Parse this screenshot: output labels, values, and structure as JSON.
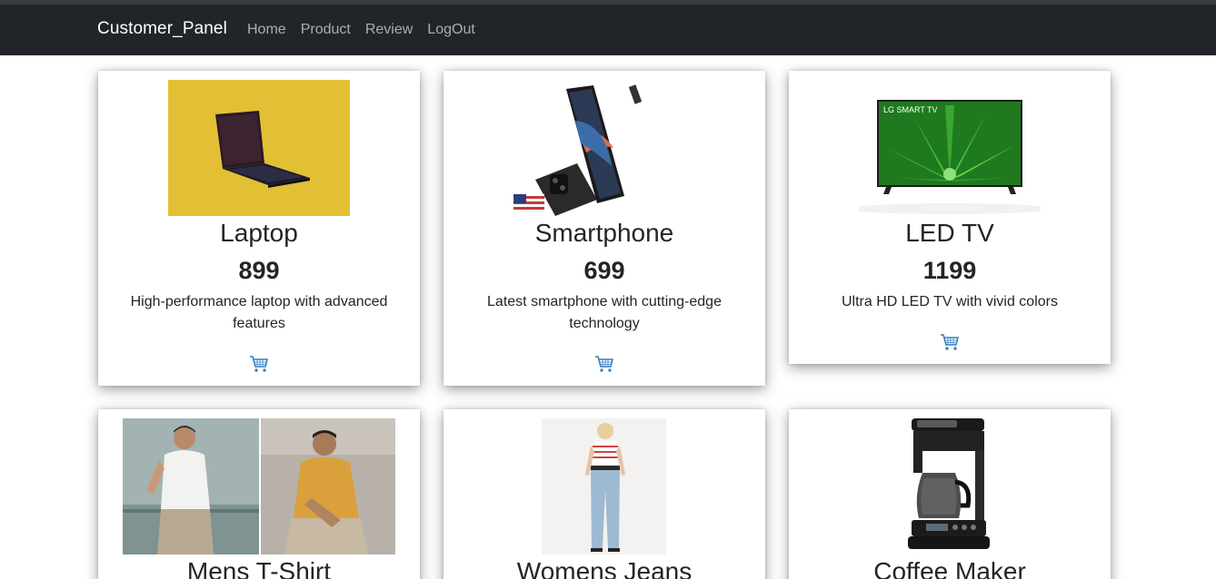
{
  "navbar": {
    "brand": "Customer_Panel",
    "links": [
      "Home",
      "Product",
      "Review",
      "LogOut"
    ]
  },
  "products": [
    {
      "name": "Laptop",
      "price": "899",
      "description": "High-performance laptop with advanced features"
    },
    {
      "name": "Smartphone",
      "price": "699",
      "description": "Latest smartphone with cutting-edge technology"
    },
    {
      "name": "LED TV",
      "price": "1199",
      "description": "Ultra HD LED TV with vivid colors",
      "image_text": "LG SMART TV"
    },
    {
      "name": "Mens T-Shirt"
    },
    {
      "name": "Womens Jeans"
    },
    {
      "name": "Coffee Maker"
    }
  ],
  "icons": {
    "cart": "shopping-cart-icon"
  },
  "colors": {
    "navbar": "#212529",
    "laptop_bg": "#e2bf35",
    "cart_icon": "#3a7fc0"
  }
}
